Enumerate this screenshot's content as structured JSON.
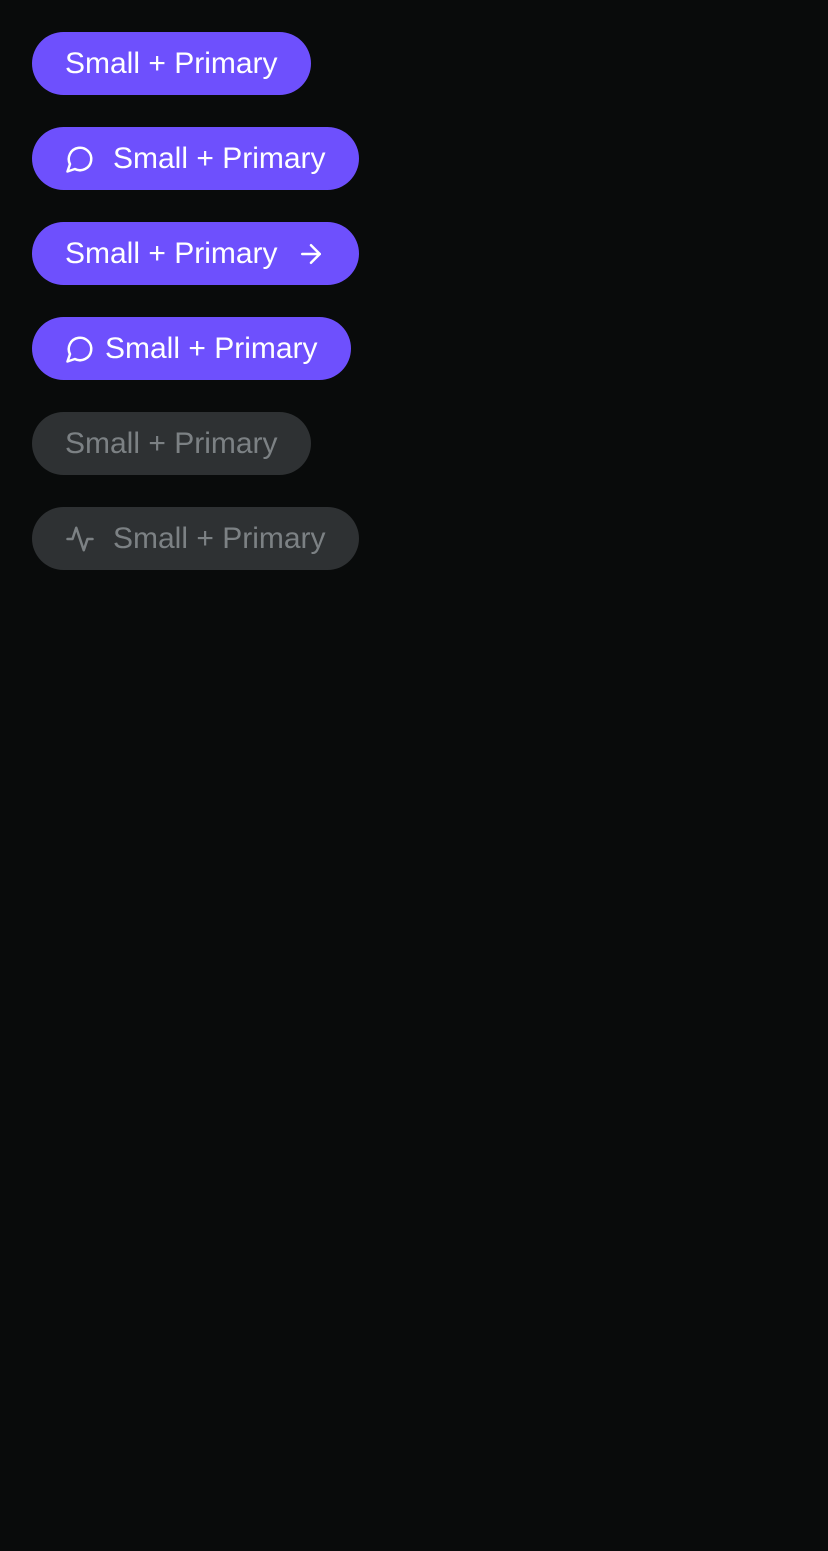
{
  "colors": {
    "background": "#090b0b",
    "primary": "#6e50fd",
    "primary_text": "#ffffff",
    "disabled_bg": "#2e3133",
    "disabled_text": "#7c8184"
  },
  "buttons": [
    {
      "label": "Small + Primary",
      "variant": "primary",
      "icon": null
    },
    {
      "label": "Small + Primary",
      "variant": "primary",
      "icon": "message-circle-icon",
      "icon_position": "leading"
    },
    {
      "label": "Small + Primary",
      "variant": "primary",
      "icon": "arrow-right-icon",
      "icon_position": "trailing"
    },
    {
      "label": "Small + Primary",
      "variant": "primary",
      "icon": "message-circle-icon",
      "icon_position": "leading"
    },
    {
      "label": "Small + Primary",
      "variant": "disabled",
      "icon": null
    },
    {
      "label": "Small + Primary",
      "variant": "disabled",
      "icon": "activity-icon",
      "icon_position": "leading"
    }
  ]
}
